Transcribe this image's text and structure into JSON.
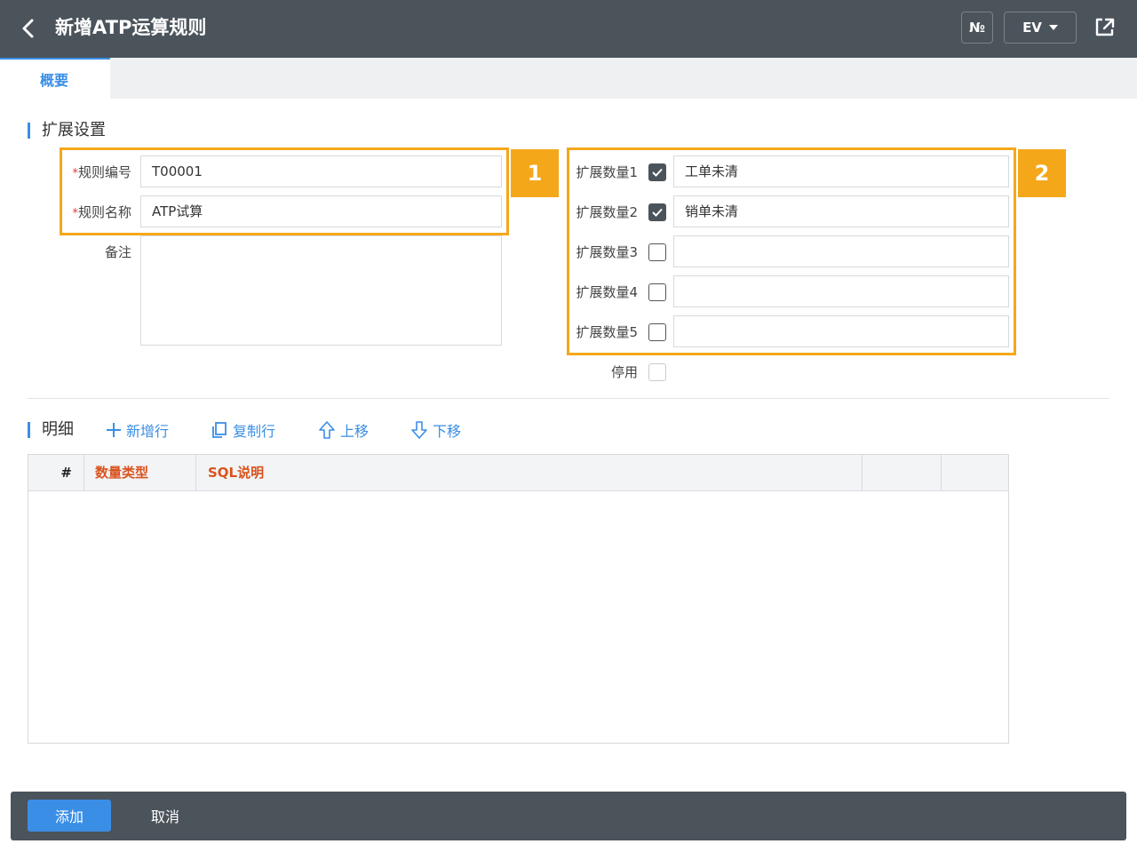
{
  "header": {
    "title": "新增ATP运算规则",
    "number_label": "№",
    "env_label": "EV"
  },
  "tabs": [
    {
      "label": "概要",
      "active": true
    }
  ],
  "settings": {
    "section_title": "扩展设置",
    "rule_code_label": "规则编号",
    "rule_code_value": "T00001",
    "rule_name_label": "规则名称",
    "rule_name_value": "ATP试算",
    "remark_label": "备注",
    "required_mark": "*",
    "ext": [
      {
        "label": "扩展数量1",
        "checked": true,
        "value": "工单未清"
      },
      {
        "label": "扩展数量2",
        "checked": true,
        "value": "销单未清"
      },
      {
        "label": "扩展数量3",
        "checked": false,
        "value": ""
      },
      {
        "label": "扩展数量4",
        "checked": false,
        "value": ""
      },
      {
        "label": "扩展数量5",
        "checked": false,
        "value": ""
      }
    ],
    "disabled_label": "停用",
    "disabled_checked": false
  },
  "callouts": {
    "one": "1",
    "two": "2"
  },
  "detail": {
    "section_title": "明细",
    "toolbar": {
      "add_row": "新增行",
      "copy_row": "复制行",
      "move_up": "上移",
      "move_down": "下移"
    },
    "columns": {
      "index": "#",
      "qty_type": "数量类型",
      "sql_desc": "SQL说明"
    }
  },
  "footer": {
    "add_label": "添加",
    "cancel_label": "取消"
  },
  "colors": {
    "accent": "#3a8ee6",
    "header_bg": "#4b535b",
    "callout": "#f5a71a",
    "column_title": "#d9531e"
  }
}
